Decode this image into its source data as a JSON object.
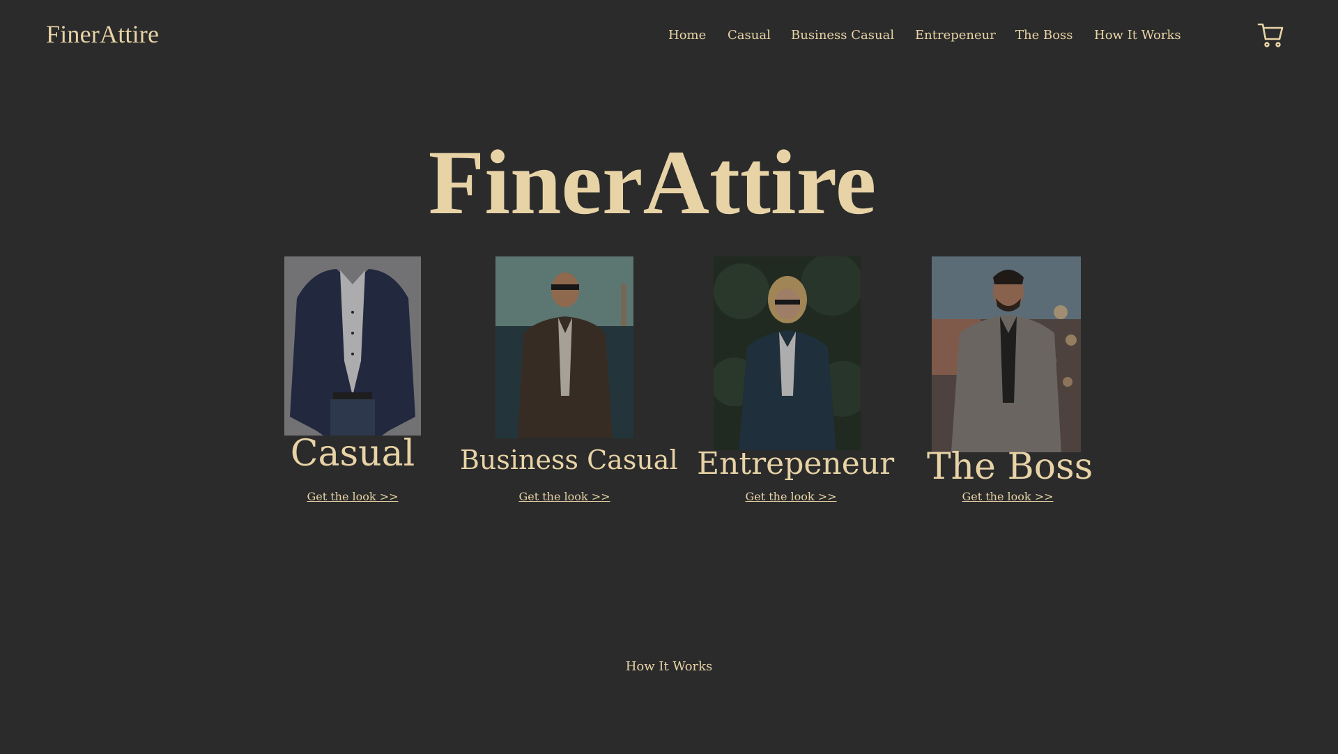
{
  "header": {
    "logo": "FinerAttire",
    "nav": [
      "Home",
      "Casual",
      "Business Casual",
      "Entrepeneur",
      "The Boss",
      "How It Works"
    ],
    "cart_icon": "shopping-cart-icon"
  },
  "hero": {
    "title": "FinerAttire"
  },
  "collections": [
    {
      "name": "Casual",
      "cta": "Get the look >>"
    },
    {
      "name": "Business Casual",
      "cta": "Get the look >>"
    },
    {
      "name": "Entrepeneur",
      "cta": "Get the look >>"
    },
    {
      "name": "The Boss",
      "cta": "Get the look >>"
    }
  ],
  "footer": {
    "how_it_works": "How It Works"
  },
  "colors": {
    "background": "#2b2b2b",
    "accent": "#e8d3a6"
  }
}
